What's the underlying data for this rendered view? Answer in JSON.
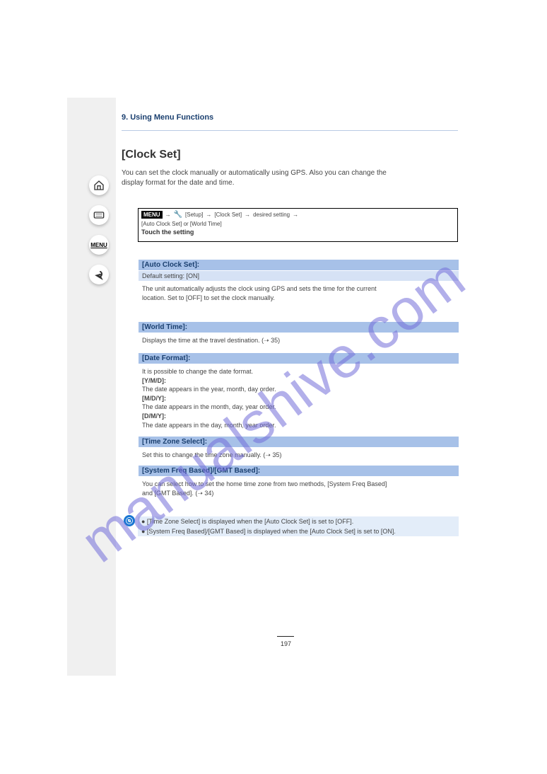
{
  "sidebar": {
    "menu_label": "MENU"
  },
  "header": {
    "title": "9. Using Menu Functions"
  },
  "section": {
    "title": "[Clock Set]",
    "desc1": "You can set the clock manually or automatically using GPS. Also you can change the",
    "desc2": "display format for the date and time."
  },
  "menubox": {
    "tag": "MENU",
    "path1": "[Setup]",
    "path2": "[Clock Set]",
    "path3": "desired setting",
    "path4": "[Auto Clock Set] or [World Time]",
    "setting": "Touch the setting"
  },
  "options": [
    {
      "title": "[Auto Clock Set]:",
      "sub": "Default setting: [ON]",
      "body1": "The unit automatically adjusts the clock using GPS and sets the time for the current",
      "body2": "location. Set to [OFF] to set the clock manually."
    },
    {
      "title": "[World Time]:",
      "body1": "Displays the time at the travel destination. (➝ 35)"
    },
    {
      "title": "[Date Format]:",
      "body1": "It is possible to change the date format.",
      "body2": "[Y/M/D]:",
      "body3": "The date appears in the year, month, day order.",
      "body4": "[M/D/Y]:",
      "body5": "The date appears in the month, day, year order.",
      "body6": "[D/M/Y]:",
      "body7": "The date appears in the day, month, year order."
    },
    {
      "title": "[Time Zone Select]:",
      "body1": "Set this to change the time zone manually. (➝ 35)"
    },
    {
      "title": "[System Freq Based]/[GMT Based]:",
      "body1": "You can select how to set the home time zone from two methods, [System Freq Based]",
      "body2": "and [GMT Based]. (➝ 34)"
    }
  ],
  "note": {
    "line1": "● [Time Zone Select] is displayed when the [Auto Clock Set] is set to [OFF].",
    "line2": "● [System Freq Based]/[GMT Based] is displayed when the [Auto Clock Set] is set to [ON]."
  },
  "footer": {
    "page": "197"
  },
  "watermark": "manualshive.com"
}
